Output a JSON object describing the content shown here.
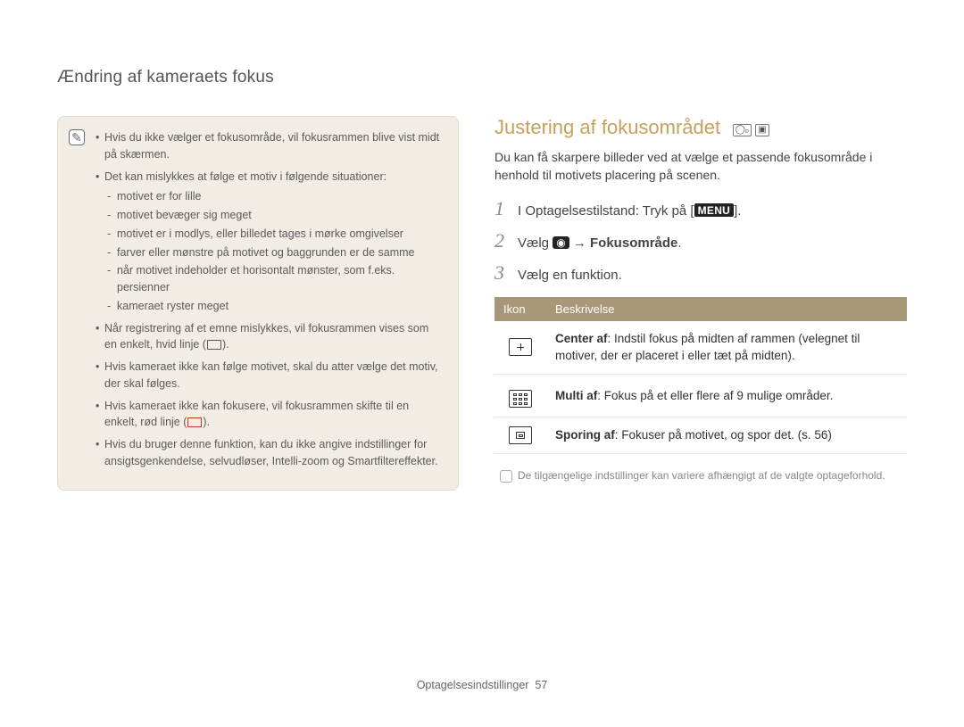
{
  "header": {
    "title": "Ændring af kameraets fokus"
  },
  "noteBox": {
    "icon": "✎",
    "b1": "Hvis du ikke vælger et fokusområde, vil fokusrammen blive vist midt på skærmen.",
    "b2": "Det kan mislykkes at følge et motiv i følgende situationer:",
    "b2s1": "motivet er for lille",
    "b2s2": "motivet bevæger sig meget",
    "b2s3": "motivet er i modlys, eller billedet tages i mørke omgivelser",
    "b2s4": "farver eller mønstre på motivet og baggrunden er de samme",
    "b2s5": "når motivet indeholder et horisontalt mønster, som f.eks. persienner",
    "b2s6": "kameraet ryster meget",
    "b3a": "Når registrering af et emne mislykkes, vil fokusrammen vises som en enkelt, hvid linje (",
    "b3b": ").",
    "b4": "Hvis kameraet ikke kan følge motivet, skal du atter vælge det motiv, der skal følges.",
    "b5a": "Hvis kameraet ikke kan fokusere, vil fokusrammen skifte til en enkelt, rød linje (",
    "b5b": ").",
    "b6": "Hvis du bruger denne funktion, kan du ikke angive indstillinger for ansigtsgenkendelse, selvudløser, Intelli-zoom og Smartfiltereffekter."
  },
  "right": {
    "title": "Justering af fokusområdet",
    "intro": "Du kan få skarpere billeder ved at vælge et passende fokusområde i henhold til motivets placering på scenen.",
    "step1a": "I Optagelsestilstand: Tryk på [",
    "step1menu": "MENU",
    "step1b": "].",
    "step2a": "Vælg ",
    "step2arrow": " → ",
    "step2b": "Fokusområde",
    "step2c": ".",
    "step3": "Vælg en funktion.",
    "thIcon": "Ikon",
    "thDesc": "Beskrivelse",
    "r1t": "Center af",
    "r1d": ": Indstil fokus på midten af rammen (velegnet til motiver, der er placeret i eller tæt på midten).",
    "r2t": "Multi af",
    "r2d": ": Fokus på et eller flere af 9 mulige områder.",
    "r3t": "Sporing af",
    "r3d": ": Fokuser på motivet, og spor det. (s. 56)",
    "tableNote": "De tilgængelige indstillinger kan variere afhængigt af de valgte optageforhold."
  },
  "footer": {
    "section": "Optagelsesindstillinger",
    "page": "57"
  }
}
